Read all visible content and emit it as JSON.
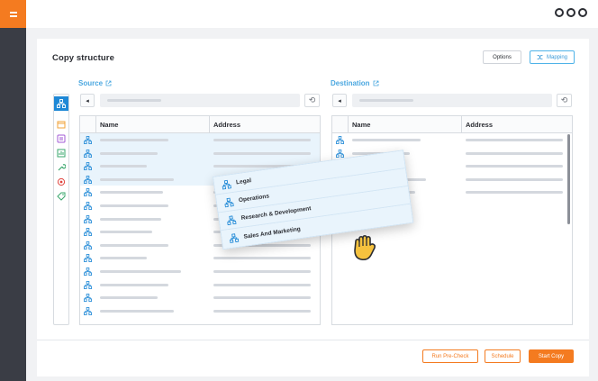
{
  "app": {
    "menu_icon": "more-circles-icon"
  },
  "page": {
    "title": "Copy structure",
    "options_label": "Options",
    "mapping_label": "Mapping"
  },
  "source": {
    "label": "Source",
    "columns": [
      "Name",
      "Address"
    ]
  },
  "destination": {
    "label": "Destination",
    "columns": [
      "Name",
      "Address"
    ]
  },
  "drag_items": [
    "Legal",
    "Operations",
    "Research & Development",
    "Sales And Marketing"
  ],
  "footer": {
    "precheck_label": "Run Pre-Check",
    "schedule_label": "Schedule",
    "start_label": "Start Copy"
  },
  "colors": {
    "accent_orange": "#f47b20",
    "accent_blue": "#1e88d6",
    "link_blue": "#4aa7e0",
    "rail_dark": "#3a3d45"
  }
}
